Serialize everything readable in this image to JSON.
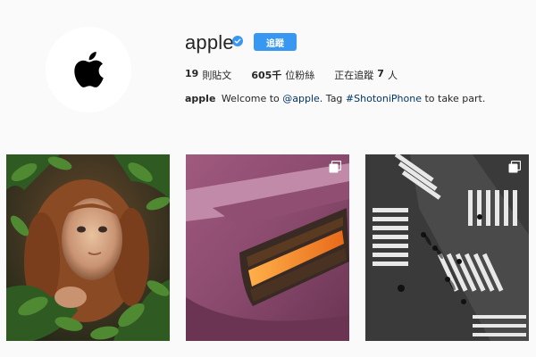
{
  "profile": {
    "username": "apple",
    "verified_icon": "verified-badge-icon",
    "follow_label": "追蹤",
    "avatar_icon": "apple-logo-icon"
  },
  "stats": {
    "posts_count": "19",
    "posts_label": "則貼文",
    "followers_count": "605千",
    "followers_label": "位粉絲",
    "following_label": "正在追蹤",
    "following_count": "7",
    "following_unit": "人"
  },
  "bio": {
    "name": "apple",
    "text_1": "Welcome to",
    "mention": "@apple",
    "text_2": ". Tag",
    "hashtag": "#ShotoniPhone",
    "text_3": "to take part."
  },
  "posts": [
    {
      "subject": "child-among-leaves",
      "multi": false
    },
    {
      "subject": "purple-car-taillight",
      "multi": true,
      "icon": "multiple-photos-icon"
    },
    {
      "subject": "crosswalk-aerial-bw",
      "multi": true,
      "icon": "multiple-photos-icon"
    }
  ],
  "colors": {
    "background": "#fafafa",
    "follow_button": "#3897f0",
    "link": "#003569"
  }
}
